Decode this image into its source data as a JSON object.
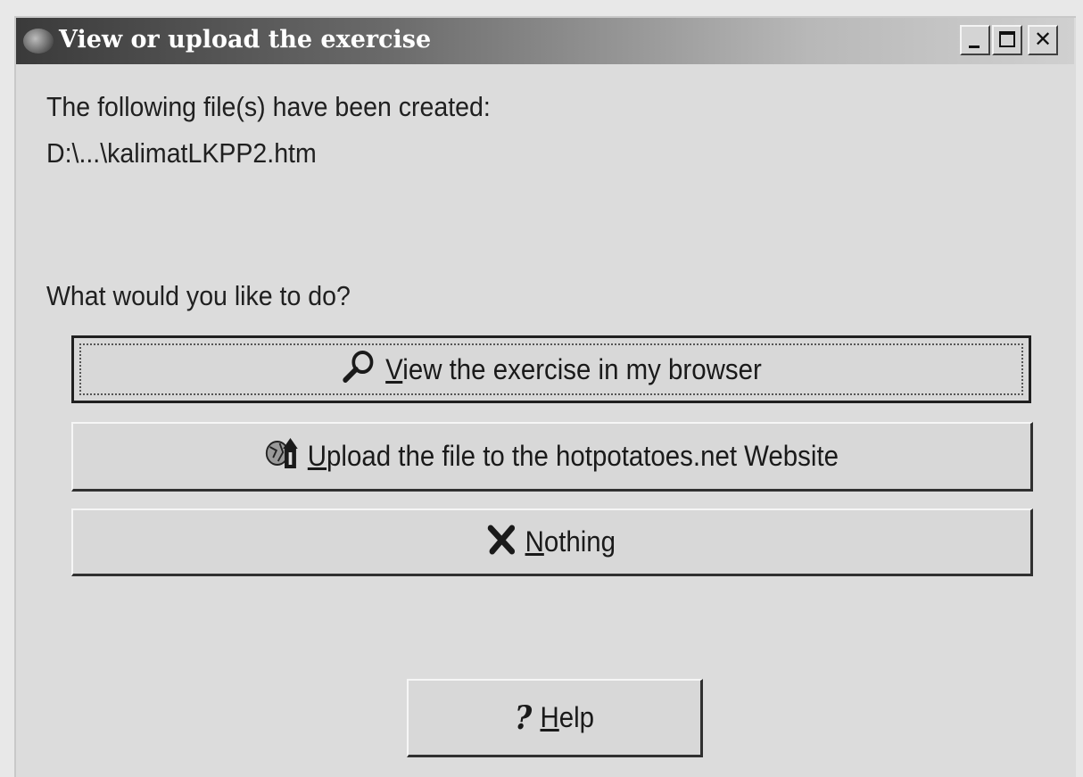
{
  "window": {
    "title": "View or upload the exercise"
  },
  "body": {
    "created_label": "The following file(s) have been created:",
    "file_path": "D:\\...\\kalimatLKPP2.htm",
    "question": "What would you like to do?"
  },
  "buttons": {
    "view": {
      "accel": "V",
      "rest": "iew the exercise in my browser",
      "icon": "magnifier-icon"
    },
    "upload": {
      "accel": "U",
      "rest": "pload the file to the hotpotatoes.net Website",
      "icon": "upload-icon"
    },
    "nothing": {
      "accel": "N",
      "rest": "othing",
      "icon": "x-icon"
    },
    "help": {
      "accel": "H",
      "rest": "elp",
      "icon": "question-icon"
    }
  },
  "colors": {
    "titlebar_dark": "#3a3a3a",
    "titlebar_light": "#d0d0d0",
    "window_bg": "#dcdcdc",
    "text": "#202020"
  }
}
